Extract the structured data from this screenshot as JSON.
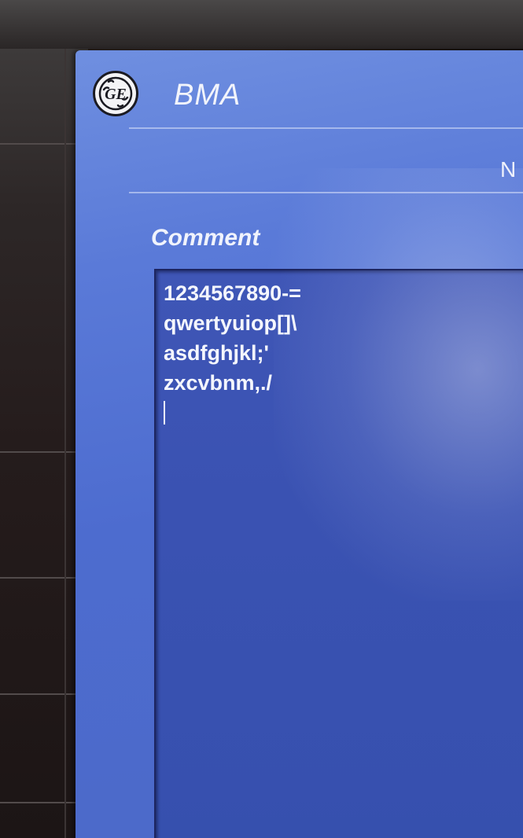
{
  "app": {
    "title": "BMA",
    "logo_icon": "ge-logo-icon"
  },
  "header": {
    "right_label": "N"
  },
  "comment": {
    "label": "Comment",
    "lines": [
      "1234567890-=",
      "qwertyuiop[]\\",
      "asdfghjkl;'",
      "zxcvbnm,./"
    ]
  },
  "colors": {
    "dialog_background": "#5a7ad8",
    "text_area_background": "#3a52b2",
    "text": "#f4f6fd"
  }
}
